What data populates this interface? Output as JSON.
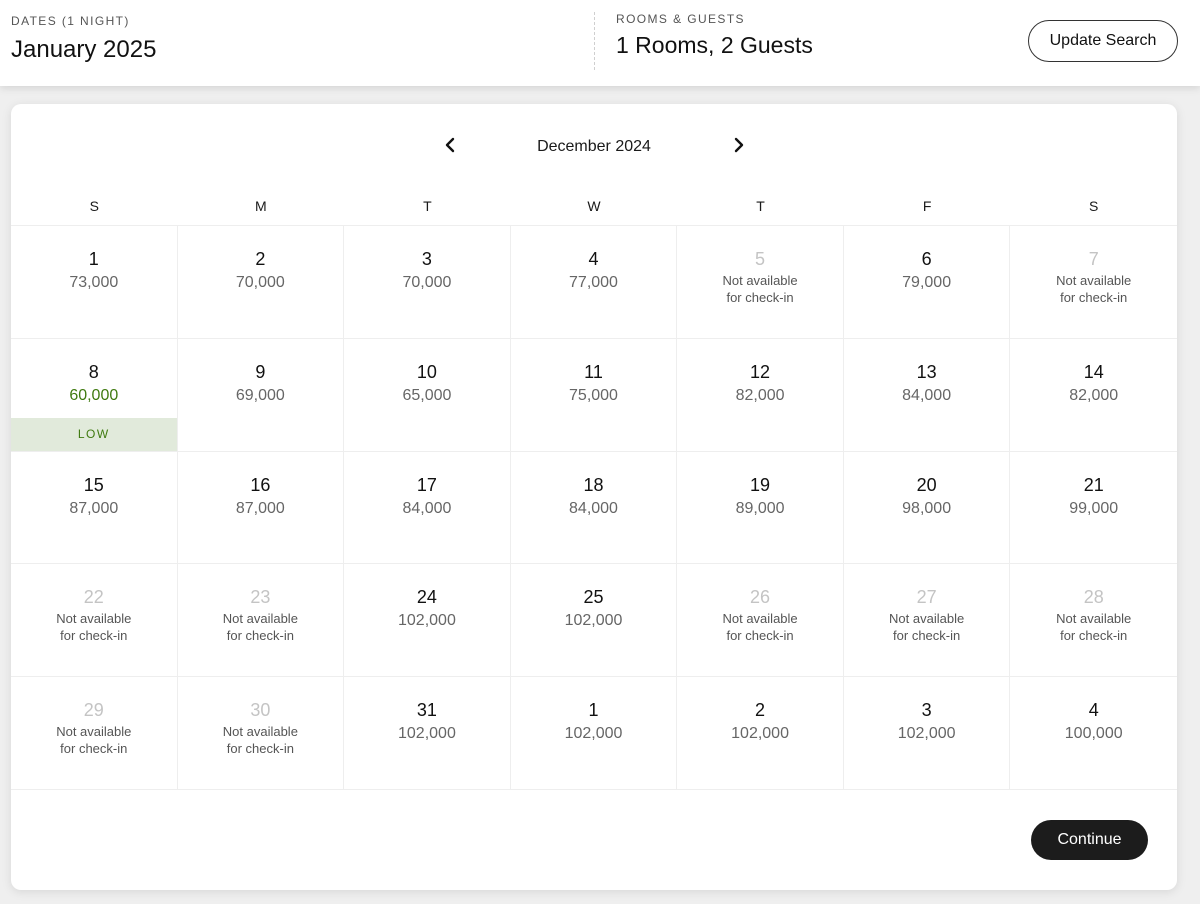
{
  "header": {
    "dates_label": "DATES (1 NIGHT)",
    "dates_value": "January 2025",
    "rooms_label": "ROOMS & GUESTS",
    "rooms_value": "1 Rooms, 2 Guests",
    "update_button": "Update Search"
  },
  "calendar": {
    "month_title": "December 2024",
    "prev_icon": "chevron-left-icon",
    "next_icon": "chevron-right-icon",
    "weekdays": [
      "S",
      "M",
      "T",
      "W",
      "T",
      "F",
      "S"
    ],
    "unavailable_text": "Not available for check-in",
    "low_label": "LOW",
    "low_color": "#3f7a10",
    "days": [
      {
        "day": "1",
        "price": "73,000"
      },
      {
        "day": "2",
        "price": "70,000"
      },
      {
        "day": "3",
        "price": "70,000"
      },
      {
        "day": "4",
        "price": "77,000"
      },
      {
        "day": "5",
        "unavailable": true
      },
      {
        "day": "6",
        "price": "79,000"
      },
      {
        "day": "7",
        "unavailable": true
      },
      {
        "day": "8",
        "price": "60,000",
        "low": true
      },
      {
        "day": "9",
        "price": "69,000"
      },
      {
        "day": "10",
        "price": "65,000"
      },
      {
        "day": "11",
        "price": "75,000"
      },
      {
        "day": "12",
        "price": "82,000"
      },
      {
        "day": "13",
        "price": "84,000"
      },
      {
        "day": "14",
        "price": "82,000"
      },
      {
        "day": "15",
        "price": "87,000"
      },
      {
        "day": "16",
        "price": "87,000"
      },
      {
        "day": "17",
        "price": "84,000"
      },
      {
        "day": "18",
        "price": "84,000"
      },
      {
        "day": "19",
        "price": "89,000"
      },
      {
        "day": "20",
        "price": "98,000"
      },
      {
        "day": "21",
        "price": "99,000"
      },
      {
        "day": "22",
        "unavailable": true
      },
      {
        "day": "23",
        "unavailable": true
      },
      {
        "day": "24",
        "price": "102,000"
      },
      {
        "day": "25",
        "price": "102,000"
      },
      {
        "day": "26",
        "unavailable": true
      },
      {
        "day": "27",
        "unavailable": true
      },
      {
        "day": "28",
        "unavailable": true
      },
      {
        "day": "29",
        "unavailable": true
      },
      {
        "day": "30",
        "unavailable": true
      },
      {
        "day": "31",
        "price": "102,000"
      },
      {
        "day": "1",
        "price": "102,000"
      },
      {
        "day": "2",
        "price": "102,000"
      },
      {
        "day": "3",
        "price": "102,000"
      },
      {
        "day": "4",
        "price": "100,000"
      }
    ]
  },
  "footer": {
    "continue_button": "Continue"
  }
}
